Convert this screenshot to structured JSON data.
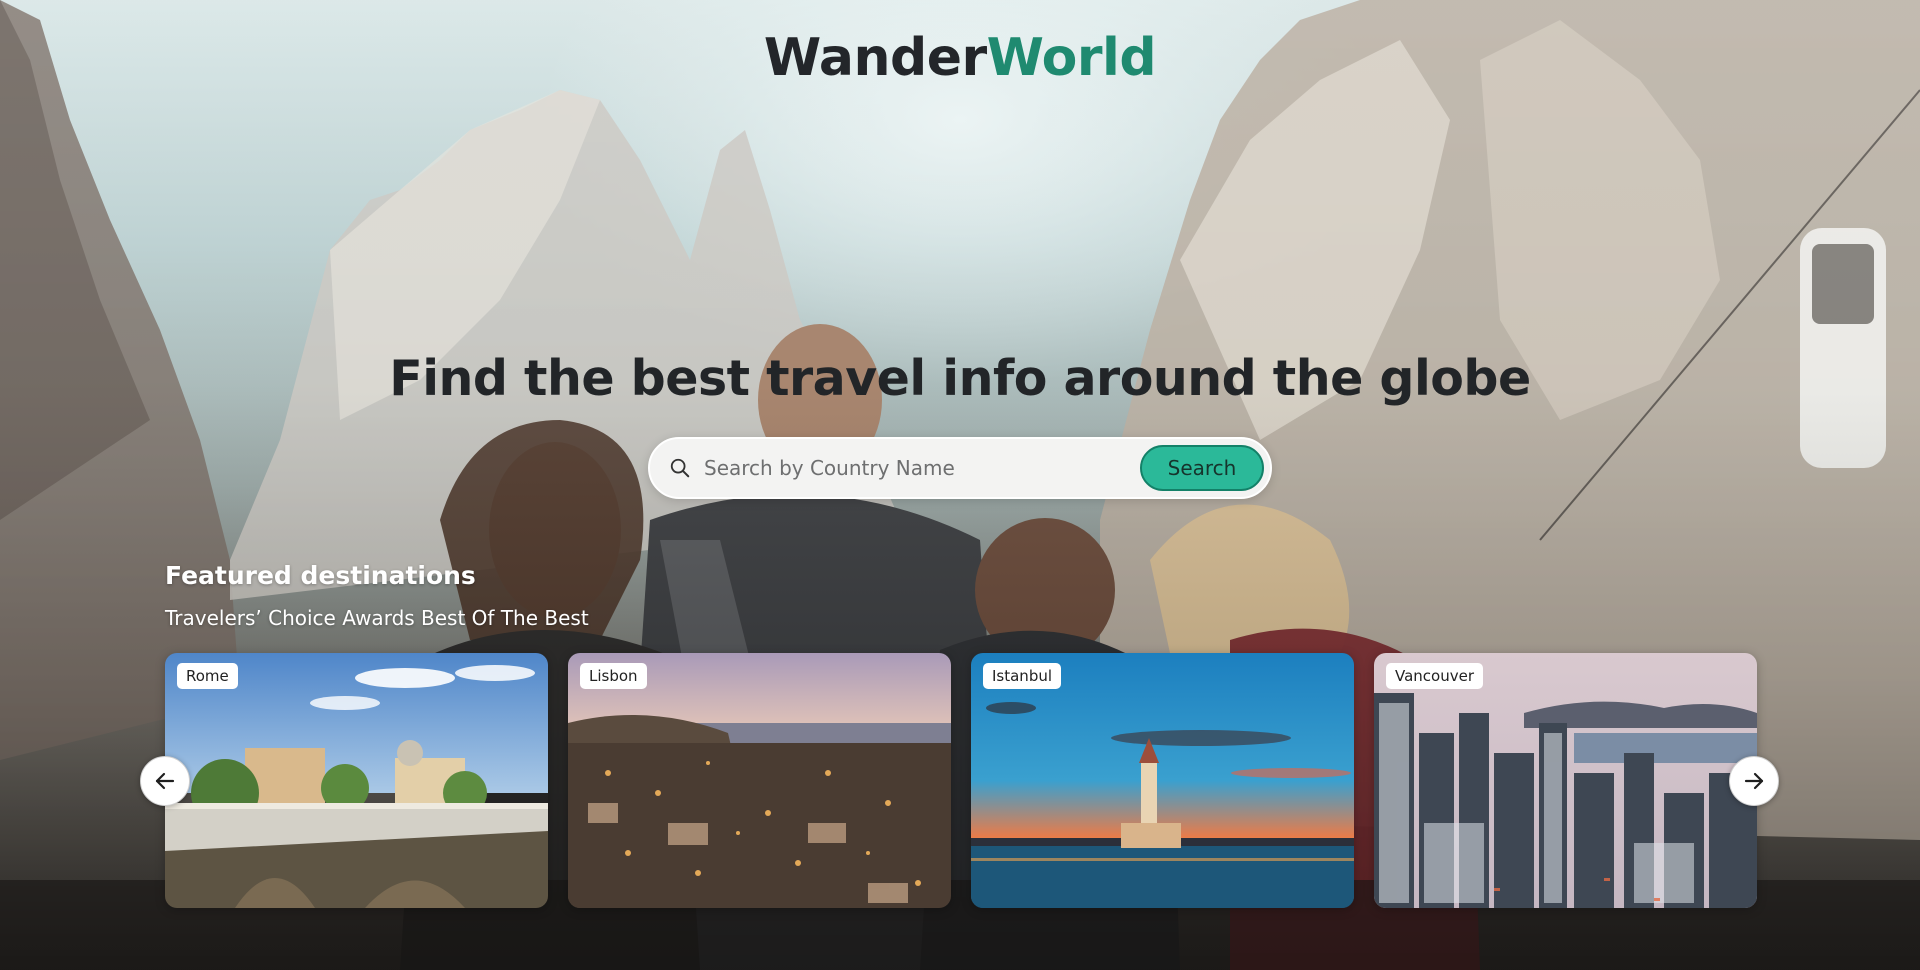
{
  "logo": {
    "part1": "Wander",
    "part2": "World"
  },
  "hero": {
    "headline": "Find the best travel info around the globe"
  },
  "search": {
    "placeholder": "Search by Country Name",
    "button_label": "Search",
    "icon": "search-icon"
  },
  "featured": {
    "title": "Featured destinations",
    "subtitle": "Travelers’ Choice Awards Best Of The Best",
    "destinations": [
      {
        "label": "Rome"
      },
      {
        "label": "Lisbon"
      },
      {
        "label": "Istanbul"
      },
      {
        "label": "Vancouver"
      }
    ],
    "prev_icon": "arrow-left-icon",
    "next_icon": "arrow-right-icon"
  },
  "colors": {
    "brand_dark": "#23262a",
    "brand_accent": "#1f8a70",
    "search_button": "#2bb999"
  }
}
